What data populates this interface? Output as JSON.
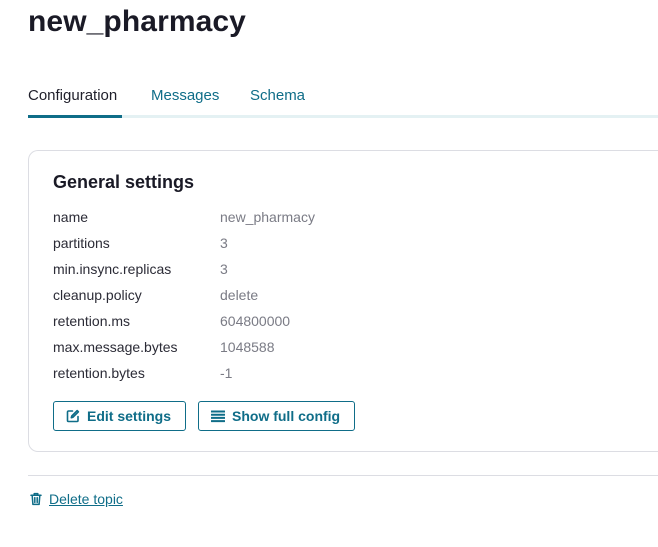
{
  "topic": {
    "name": "new_pharmacy"
  },
  "tabs": [
    {
      "label": "Configuration",
      "active": true
    },
    {
      "label": "Messages",
      "active": false
    },
    {
      "label": "Schema",
      "active": false
    }
  ],
  "general_settings": {
    "title": "General settings",
    "rows": [
      {
        "key": "name",
        "value": "new_pharmacy"
      },
      {
        "key": "partitions",
        "value": "3"
      },
      {
        "key": "min.insync.replicas",
        "value": "3"
      },
      {
        "key": "cleanup.policy",
        "value": "delete"
      },
      {
        "key": "retention.ms",
        "value": "604800000"
      },
      {
        "key": "max.message.bytes",
        "value": "1048588"
      },
      {
        "key": "retention.bytes",
        "value": "-1"
      }
    ],
    "edit_button": {
      "label": "Edit settings",
      "icon": "edit-icon"
    },
    "show_config_button": {
      "label": "Show full config",
      "icon": "list-icon"
    }
  },
  "delete_topic": {
    "label": "Delete topic",
    "icon": "trash-icon"
  },
  "colors": {
    "accent": "#0f6d88",
    "text": "#1f1f2a",
    "muted": "#7a7b85",
    "border": "#dcdde3"
  }
}
